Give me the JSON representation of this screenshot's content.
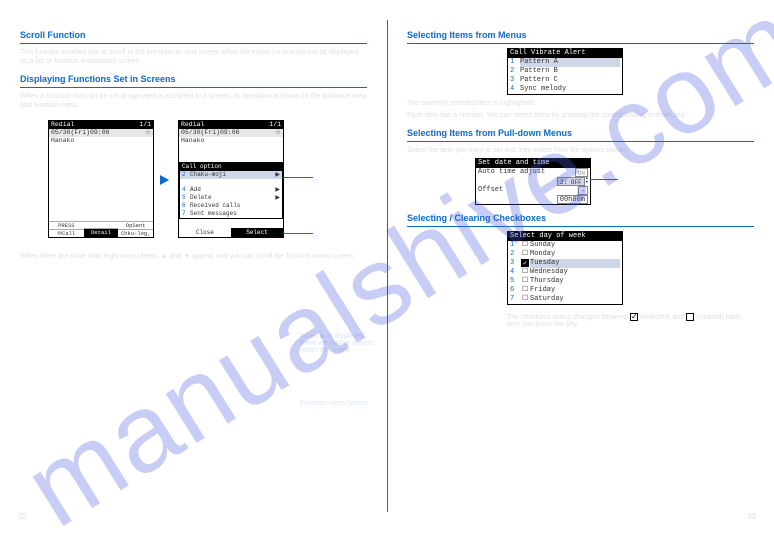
{
  "watermark": "manualshive.com",
  "left": {
    "heading1": "Scroll Function",
    "para1": "This function enables you to scroll to the previous or next screen when the entire content cannot be displayed on a list or function explanation screen.",
    "heading2": "Displaying Functions Set in Screens",
    "para2": "When a function that can be set or operated is assigned to a screen, its operation is shown in the guidance area and function menu.",
    "screen1": {
      "topbar_left": "Redial",
      "topbar_right": "1/1",
      "date": "05/30(Fri)09:06",
      "icon": "☆",
      "name": "Hanako",
      "soft_tl": "PRESS",
      "soft_bl": "✉Call",
      "soft_tc": "Detail",
      "soft_br": "Chku-log,",
      "soft_tr": "OpSent"
    },
    "screen2": {
      "topbar_left": "Redial",
      "topbar_right": "1/1",
      "date": "05/30(Fri)09:06",
      "icon": "☆",
      "name": "Hanako",
      "menu_title": "Call option",
      "items": [
        {
          "n": "2",
          "t": "Chaku-moji"
        },
        {
          "n": "4",
          "t": "Add"
        },
        {
          "n": "5",
          "t": "Delete"
        },
        {
          "n": "6",
          "t": "Received calls"
        },
        {
          "n": "7",
          "t": "Sent messages"
        }
      ],
      "close": "Close",
      "select": "Select"
    },
    "annot1": "When ▶ is displayed, there are further options under this menu",
    "annot2": "Function menu button",
    "info1": "When there are more than eight menu items, ▲ and ▼ appear and you can scroll the function menu screen.",
    "page": "32"
  },
  "right": {
    "heading1": "Selecting Items from Menus",
    "screen_vibrate": {
      "title": "Call Vibrate Alert",
      "rows": [
        {
          "n": "1",
          "t": "Pattern A"
        },
        {
          "n": "2",
          "t": "Pattern B"
        },
        {
          "n": "3",
          "t": "Pattern C"
        },
        {
          "n": "4",
          "t": "Sync melody"
        }
      ]
    },
    "info_vibrate1": "The currently selected item is highlighted.",
    "info_vibrate2": "Each item has a number. You can select items by pressing the corresponding number key.",
    "heading2": "Selecting Items from Pull-down Menus",
    "info_pd": "Select the item you want to set and then select from the options shown.",
    "screen_datetime": {
      "title": "Set date and time",
      "row1_label": "Auto time adjust",
      "row1_value": "ON",
      "row2_label": " ",
      "row2_value": "2: OFF",
      "row3_label": "Offset",
      "row3_value": "+",
      "row4_value": "00h00m"
    },
    "heading3": "Selecting / Clearing Checkboxes",
    "screen_days": {
      "title": "Select day of week",
      "rows": [
        {
          "n": "1",
          "d": "Sunday",
          "c": false,
          "hl": false
        },
        {
          "n": "2",
          "d": "Monday",
          "c": false,
          "hl": false
        },
        {
          "n": "3",
          "d": "Tuesday",
          "c": true,
          "hl": true
        },
        {
          "n": "4",
          "d": "Wednesday",
          "c": false,
          "hl": false
        },
        {
          "n": "5",
          "d": "Thursday",
          "c": false,
          "hl": false
        },
        {
          "n": "6",
          "d": "Friday",
          "c": false,
          "hl": false
        },
        {
          "n": "7",
          "d": "Saturday",
          "c": false,
          "hl": false
        }
      ]
    },
    "check_note_pre": "The checkbox status changes between ",
    "check_note_mid": " (selected) and ",
    "check_note_post": " (cleared) each time you press the key.",
    "page": "33"
  }
}
